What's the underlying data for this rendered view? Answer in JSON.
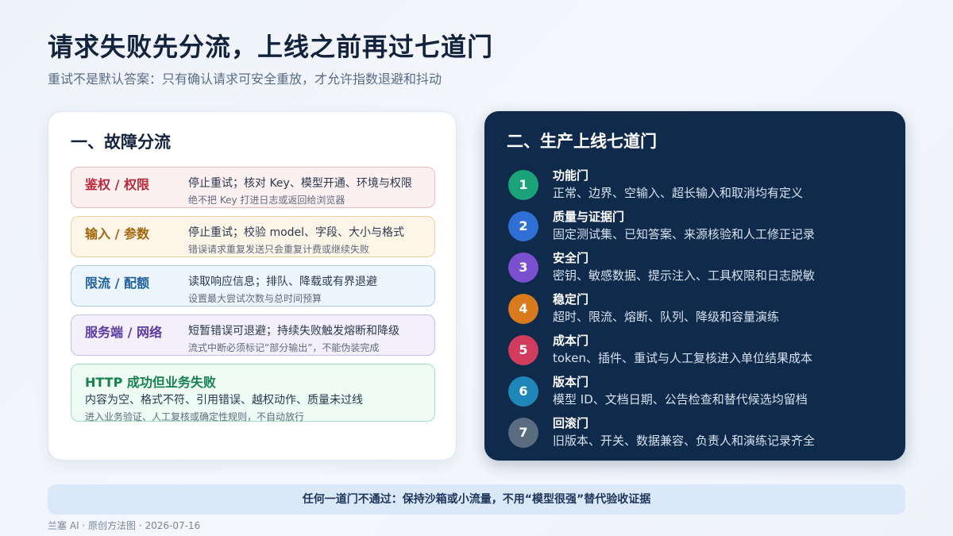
{
  "title": "请求失败先分流，上线之前再过七道门",
  "subtitle": "重试不是默认答案：只有确认请求可安全重放，才允许指数退避和抖动",
  "left": {
    "heading": "一、故障分流",
    "cards": [
      {
        "name": "鉴权 / 权限",
        "main": "停止重试；核对 Key、模型开通、环境与权限",
        "note": "绝不把 Key 打进日志或返回给浏览器"
      },
      {
        "name": "输入 / 参数",
        "main": "停止重试；校验 model、字段、大小与格式",
        "note": "错误请求重复发送只会重复计费或继续失败"
      },
      {
        "name": "限流 / 配额",
        "main": "读取响应信息；排队、降载或有界退避",
        "note": "设置最大尝试次数与总时间预算"
      },
      {
        "name": "服务端 / 网络",
        "main": "短暂错误可退避；持续失败触发熔断和降级",
        "note": "流式中断必须标记“部分输出”，不能伪装完成"
      },
      {
        "name": "HTTP 成功但业务失败",
        "main": "内容为空、格式不符、引用错误、越权动作、质量未过线",
        "note": "进入业务验证、人工复核或确定性规则，不自动放行"
      }
    ]
  },
  "right": {
    "heading": "二、生产上线七道门",
    "gates": [
      {
        "num": "1",
        "name": "功能门",
        "desc": "正常、边界、空输入、超长输入和取消均有定义",
        "color": "#1aa37a"
      },
      {
        "num": "2",
        "name": "质量与证据门",
        "desc": "固定测试集、已知答案、来源核验和人工修正记录",
        "color": "#2f6fd6"
      },
      {
        "num": "3",
        "name": "安全门",
        "desc": "密钥、敏感数据、提示注入、工具权限和日志脱敏",
        "color": "#7a4fd0"
      },
      {
        "num": "4",
        "name": "稳定门",
        "desc": "超时、限流、熔断、队列、降级和容量演练",
        "color": "#d97a1c"
      },
      {
        "num": "5",
        "name": "成本门",
        "desc": "token、插件、重试与人工复核进入单位结果成本",
        "color": "#d13c5c"
      },
      {
        "num": "6",
        "name": "版本门",
        "desc": "模型 ID、文档日期、公告检查和替代候选均留档",
        "color": "#1e86b8"
      },
      {
        "num": "7",
        "name": "回滚门",
        "desc": "旧版本、开关、数据兼容、负责人和演练记录齐全",
        "color": "#5b6b80"
      }
    ]
  },
  "banner": "任何一道门不通过：保持沙箱或小流量，不用“模型很强”替代验收证据",
  "footer": "兰塞 AI · 原创方法图 · 2026-07-16"
}
